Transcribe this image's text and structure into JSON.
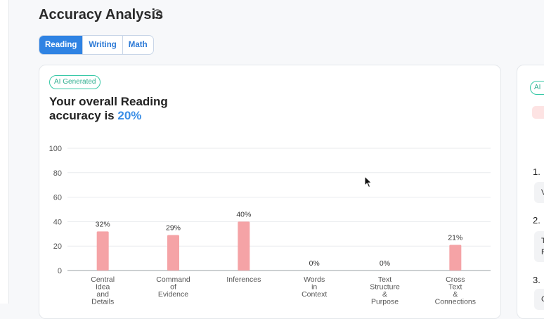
{
  "header": {
    "title": "Accuracy Analysis",
    "info_icon": "info-circle-icon"
  },
  "tabs": [
    {
      "label": "Reading",
      "active": true
    },
    {
      "label": "Writing",
      "active": false
    },
    {
      "label": "Math",
      "active": false
    }
  ],
  "card": {
    "badge": "AI Generated",
    "headline_line1": "Your overall Reading",
    "headline_line2_prefix": "accuracy is ",
    "headline_pct": "20%"
  },
  "chart_data": {
    "type": "bar",
    "categories": [
      [
        "Central",
        "Idea",
        "and",
        "Details"
      ],
      [
        "Command",
        "of",
        "Evidence"
      ],
      [
        "Inferences"
      ],
      [
        "Words",
        "in",
        "Context"
      ],
      [
        "Text",
        "Structure",
        "&",
        "Purpose"
      ],
      [
        "Cross",
        "Text",
        "&",
        "Connections"
      ]
    ],
    "values": [
      32,
      29,
      40,
      0,
      0,
      21
    ],
    "data_labels": [
      "32%",
      "29%",
      "40%",
      "0%",
      "0%",
      "21%"
    ],
    "yticks": [
      0,
      20,
      40,
      60,
      80,
      100
    ],
    "ylim": [
      0,
      100
    ],
    "grid": true,
    "bar_color": "#f5a3a6"
  },
  "right_panel": {
    "badge": "AI",
    "numbers": [
      "1.",
      "2.",
      "3."
    ],
    "box_texts": [
      "V",
      "T",
      "F",
      "C"
    ]
  },
  "colors": {
    "accent": "#2f83e3",
    "ai_green": "#38c9a7",
    "bar": "#f5a3a6"
  }
}
